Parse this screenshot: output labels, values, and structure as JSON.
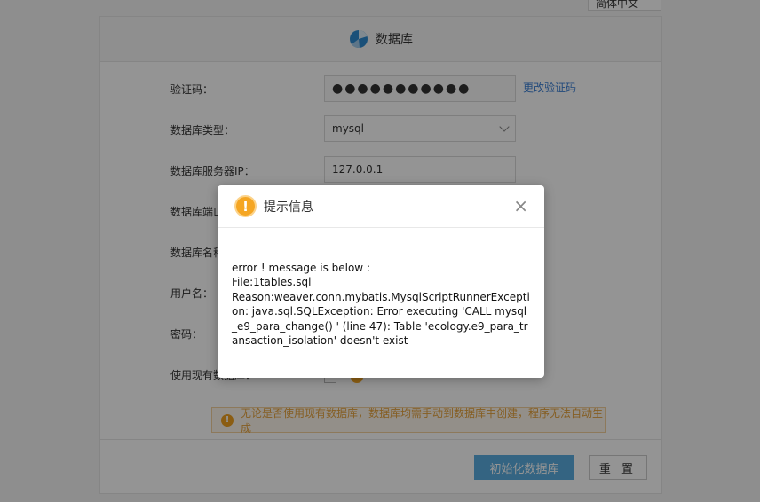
{
  "language_select": {
    "value": "简体中文"
  },
  "panel": {
    "title": "数据库",
    "icon": "database-pie-icon"
  },
  "form": {
    "captcha": {
      "label": "验证码：",
      "value": "●●●●●●●●●●●",
      "link": "更改验证码"
    },
    "db_type": {
      "label": "数据库类型：",
      "value": "mysql"
    },
    "server_ip": {
      "label": "数据库服务器IP：",
      "value": "127.0.0.1"
    },
    "db_port": {
      "label": "数据库端口："
    },
    "db_name": {
      "label": "数据库名称："
    },
    "username": {
      "label": "用户名："
    },
    "password": {
      "label": "密码："
    },
    "use_existing": {
      "label": "使用现有数据库："
    }
  },
  "notice": {
    "icon": "!",
    "text": "无论是否使用现有数据库，数据库均需手动到数据库中创建，程序无法自动生成"
  },
  "buttons": {
    "init": "初始化数据库",
    "reset": "重 置"
  },
  "modal": {
    "title": "提示信息",
    "icon": "!",
    "close": "×",
    "lines": [
      "error ! message is below :",
      "File:1tables.sql",
      "Reason:weaver.conn.mybatis.MysqlScriptRunnerException: java.sql.SQLException: Error executing 'CALL mysql_e9_para_change() ' (line 47): Table 'ecology.e9_para_transaction_isolation' doesn't exist"
    ]
  },
  "colors": {
    "primary": "#5aade0",
    "link": "#3a7fd5",
    "warning": "#f5a623"
  }
}
